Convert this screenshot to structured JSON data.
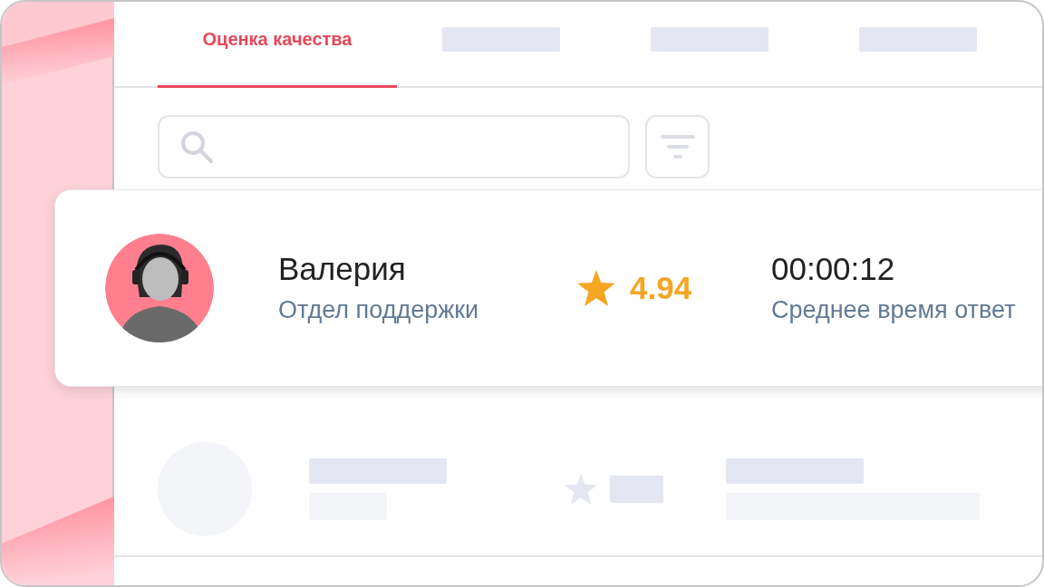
{
  "tabs": [
    {
      "kind": "label",
      "label": "Оценка качества",
      "selected": true
    },
    {
      "kind": "placeholder",
      "selected": false
    },
    {
      "kind": "placeholder",
      "selected": false
    },
    {
      "kind": "placeholder",
      "selected": false
    }
  ],
  "card": {
    "name": "Валерия",
    "department": "Отдел поддержки",
    "rating": "4.94",
    "time": "00:00:12",
    "time_caption": "Среднее время ответ"
  }
}
